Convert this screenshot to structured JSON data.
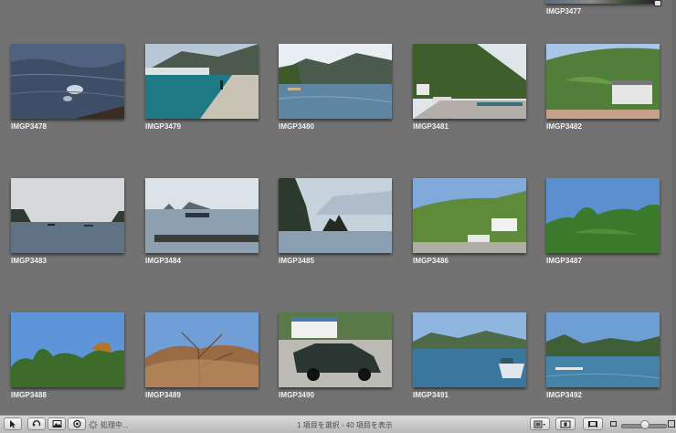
{
  "top_partial": {
    "label": "IMGP3477"
  },
  "photos": [
    {
      "name": "IMGP3478",
      "icon": "rippled-sea-water-photo"
    },
    {
      "name": "IMGP3479",
      "icon": "harbor-pier-village-photo"
    },
    {
      "name": "IMGP3480",
      "icon": "bay-mountains-photo"
    },
    {
      "name": "IMGP3481",
      "icon": "hillside-houses-road-photo"
    },
    {
      "name": "IMGP3482",
      "icon": "forest-hill-house-photo"
    },
    {
      "name": "IMGP3483",
      "icon": "grey-sea-boats-photo"
    },
    {
      "name": "IMGP3484",
      "icon": "misty-sea-islands-photo"
    },
    {
      "name": "IMGP3485",
      "icon": "rocky-headland-photo"
    },
    {
      "name": "IMGP3486",
      "icon": "coastal-village-hill-photo"
    },
    {
      "name": "IMGP3487",
      "icon": "green-trees-blue-sky-photo"
    },
    {
      "name": "IMGP3488",
      "icon": "treetops-blue-sky-photo"
    },
    {
      "name": "IMGP3489",
      "icon": "autumn-branches-photo"
    },
    {
      "name": "IMGP3490",
      "icon": "parked-car-photo"
    },
    {
      "name": "IMGP3491",
      "icon": "boat-bay-photo"
    },
    {
      "name": "IMGP3492",
      "icon": "calm-bay-hills-photo"
    }
  ],
  "toolbar": {
    "processing_label": "処理中...",
    "status_text": "1 項目を選択 - 40 項目を表示",
    "zoom_level": 0.55
  },
  "colors": {
    "background": "#727272",
    "toolbar": "#c8c8c8",
    "caption": "#f2f2f2"
  }
}
